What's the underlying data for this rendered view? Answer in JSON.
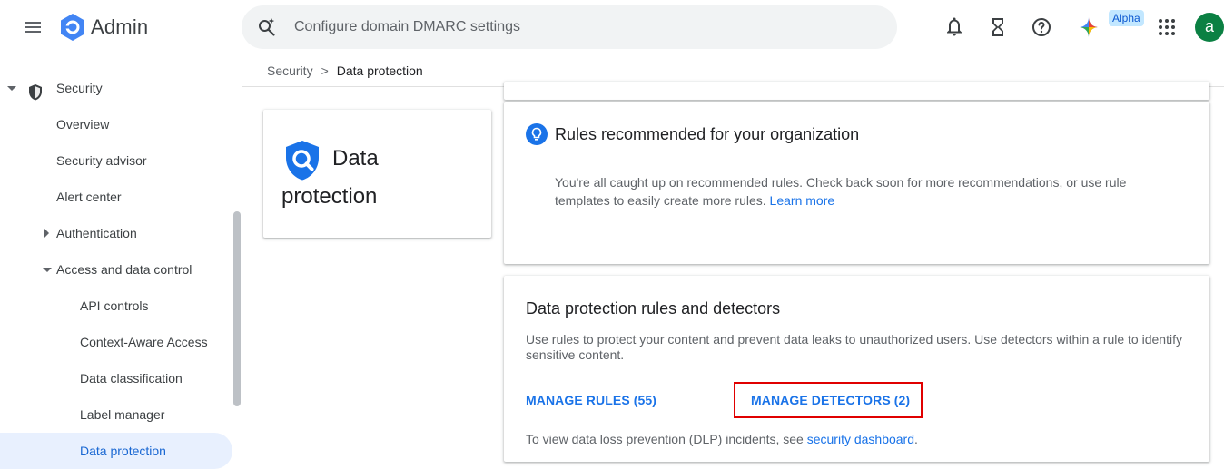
{
  "app": {
    "title": "Admin"
  },
  "search": {
    "placeholder": "Configure domain DMARC settings"
  },
  "topbar": {
    "alpha_badge": "Alpha",
    "avatar_initial": "a"
  },
  "sidebar": {
    "items": [
      {
        "label": "Security"
      },
      {
        "label": "Overview"
      },
      {
        "label": "Security advisor"
      },
      {
        "label": "Alert center"
      },
      {
        "label": "Authentication"
      },
      {
        "label": "Access and data control"
      },
      {
        "label": "API controls"
      },
      {
        "label": "Context-Aware Access"
      },
      {
        "label": "Data classification"
      },
      {
        "label": "Label manager"
      },
      {
        "label": "Data protection"
      }
    ]
  },
  "breadcrumb": {
    "parent": "Security",
    "current": "Data protection"
  },
  "page_title": {
    "line1": "Data",
    "line2": "protection"
  },
  "recommended": {
    "heading": "Rules recommended for your organization",
    "body": "You're all caught up on recommended rules. Check back soon for more recommendations, or use rule templates to easily create more rules.",
    "link": "Learn more"
  },
  "dp_rules": {
    "heading": "Data protection rules and detectors",
    "body": "Use rules to protect your content and prevent data leaks to unauthorized users. Use detectors within a rule to identify sensitive content.",
    "manage_rules": "MANAGE RULES (55)",
    "manage_detectors": "MANAGE DETECTORS (2)",
    "footer_prefix": "To view data loss prevention (DLP) incidents, see",
    "footer_link": "security dashboard",
    "footer_suffix": "."
  },
  "colors": {
    "accent": "#1a73e8",
    "highlight": "#e00000",
    "active_bg": "#e8f0fe"
  }
}
